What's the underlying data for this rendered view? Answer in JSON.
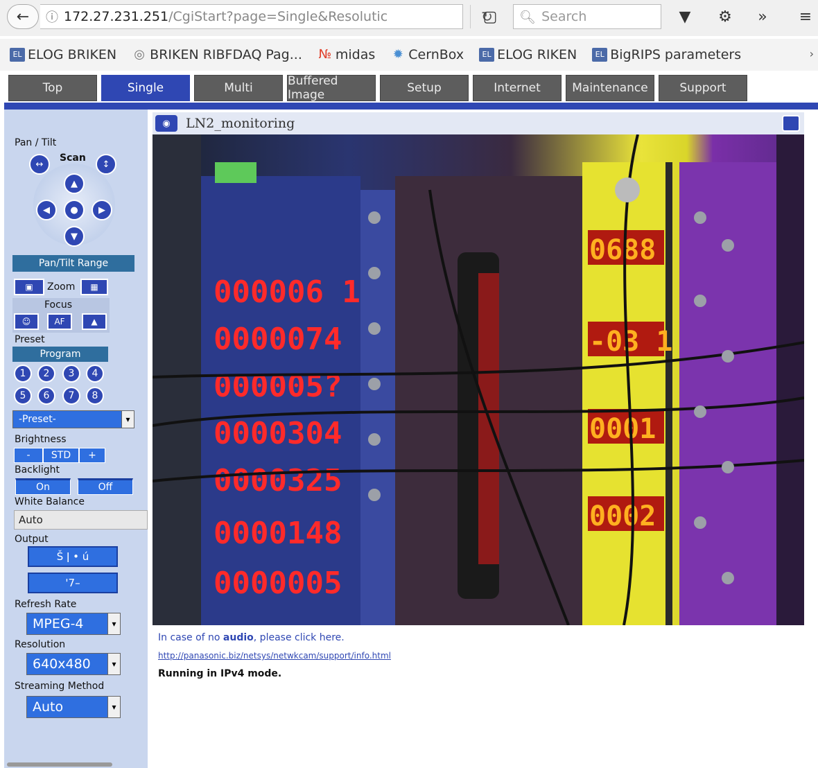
{
  "browser": {
    "url_host": "172.27.231.251",
    "url_path": "/CgiStart?page=Single&Resolutic",
    "search_placeholder": "Search"
  },
  "bookmarks": [
    {
      "label": "ELOG BRIKEN",
      "icon": "elog-icon"
    },
    {
      "label": "BRIKEN RIBFDAQ Pag...",
      "icon": "globe-icon"
    },
    {
      "label": "midas",
      "icon": "midas-icon"
    },
    {
      "label": "CernBox",
      "icon": "cernbox-icon"
    },
    {
      "label": "ELOG RIKEN",
      "icon": "elog-icon"
    },
    {
      "label": "BigRIPS parameters",
      "icon": "elog-icon"
    }
  ],
  "tabs": [
    {
      "label": "Top"
    },
    {
      "label": "Single",
      "active": true
    },
    {
      "label": "Multi"
    },
    {
      "label": "Buffered Image"
    },
    {
      "label": "Setup"
    },
    {
      "label": "Internet"
    },
    {
      "label": "Maintenance"
    },
    {
      "label": "Support"
    }
  ],
  "sidebar": {
    "pan_tilt": "Pan / Tilt",
    "scan": "Scan",
    "pantilt_range": "Pan/Tilt Range",
    "zoom": "Zoom",
    "focus": "Focus",
    "focus_af": "AF",
    "preset": "Preset",
    "program": "Program",
    "preset_numbers": [
      "1",
      "2",
      "3",
      "4",
      "5",
      "6",
      "7",
      "8"
    ],
    "preset_select": "-Preset-",
    "brightness": "Brightness",
    "brightness_minus": "-",
    "brightness_std": "STD",
    "brightness_plus": "+",
    "backlight": "Backlight",
    "backlight_on": "On",
    "backlight_off": "Off",
    "white_balance": "White Balance",
    "white_balance_value": "Auto",
    "output": "Output",
    "output_btn1": "Š ǀ • ú",
    "output_btn2": "'7–",
    "refresh_rate": "Refresh Rate",
    "refresh_rate_value": "MPEG-4",
    "resolution": "Resolution",
    "resolution_value": "640x480",
    "streaming_method": "Streaming Method",
    "streaming_method_value": "Auto"
  },
  "main": {
    "camera_title": "LN2_monitoring",
    "audio_pre": "In case of no ",
    "audio_link": "audio",
    "audio_post": ", please click here.",
    "support_link": "http://panasonic.biz/netsys/netwkcam/support/info.html",
    "mode": "Running in IPv4 mode."
  },
  "video_readouts": {
    "left": [
      "000006 1",
      "0000074",
      "000005?",
      "0000304",
      "0000325",
      "0000148",
      "0000005"
    ],
    "right": [
      "0688",
      "-03 1",
      "0001",
      "0002"
    ]
  }
}
